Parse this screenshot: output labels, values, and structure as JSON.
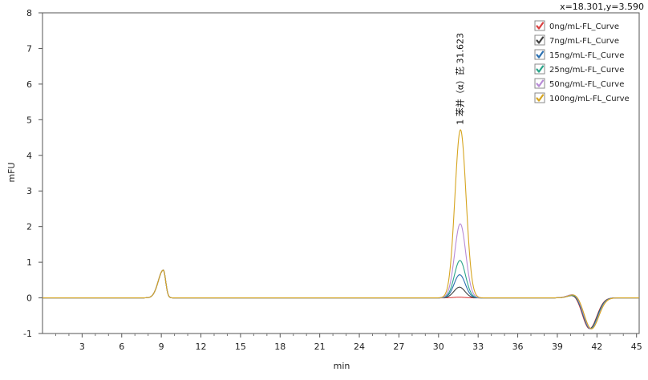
{
  "coord_readout": "x=18.301,y=3.590",
  "chart_data": {
    "type": "line",
    "xlabel": "min",
    "ylabel": "mFU",
    "xlim": [
      0,
      45.2
    ],
    "ylim": [
      -1,
      8
    ],
    "x_ticks": [
      3,
      6,
      9,
      12,
      15,
      18,
      21,
      24,
      27,
      30,
      33,
      36,
      39,
      42,
      45
    ],
    "y_ticks": [
      -1,
      0,
      1,
      2,
      3,
      4,
      5,
      6,
      7,
      8
    ],
    "grid": false,
    "legend_position": "top-right",
    "peak_annotation": {
      "text": "1 苯并（α）芘 31.623",
      "x": 31.623,
      "y": 4.72
    },
    "shared_features": {
      "solvent_peak": {
        "x": 9.15,
        "height": 0.78
      },
      "late_bump": {
        "x": 40.4,
        "height": 0.14
      },
      "late_dip": {
        "x": 41.5,
        "depth": -0.88
      }
    },
    "series": [
      {
        "name": "0ng/mL-FL_Curve",
        "color": "#d94040",
        "peak_height": 0.02
      },
      {
        "name": "7ng/mL-FL_Curve",
        "color": "#404040",
        "peak_height": 0.3
      },
      {
        "name": "15ng/mL-FL_Curve",
        "color": "#2a6fb0",
        "peak_height": 0.65
      },
      {
        "name": "25ng/mL-FL_Curve",
        "color": "#2aa58a",
        "peak_height": 1.05
      },
      {
        "name": "50ng/mL-FL_Curve",
        "color": "#b88ad6",
        "peak_height": 2.08
      },
      {
        "name": "100ng/mL-FL_Curve",
        "color": "#d6a520",
        "peak_height": 4.72
      }
    ]
  }
}
